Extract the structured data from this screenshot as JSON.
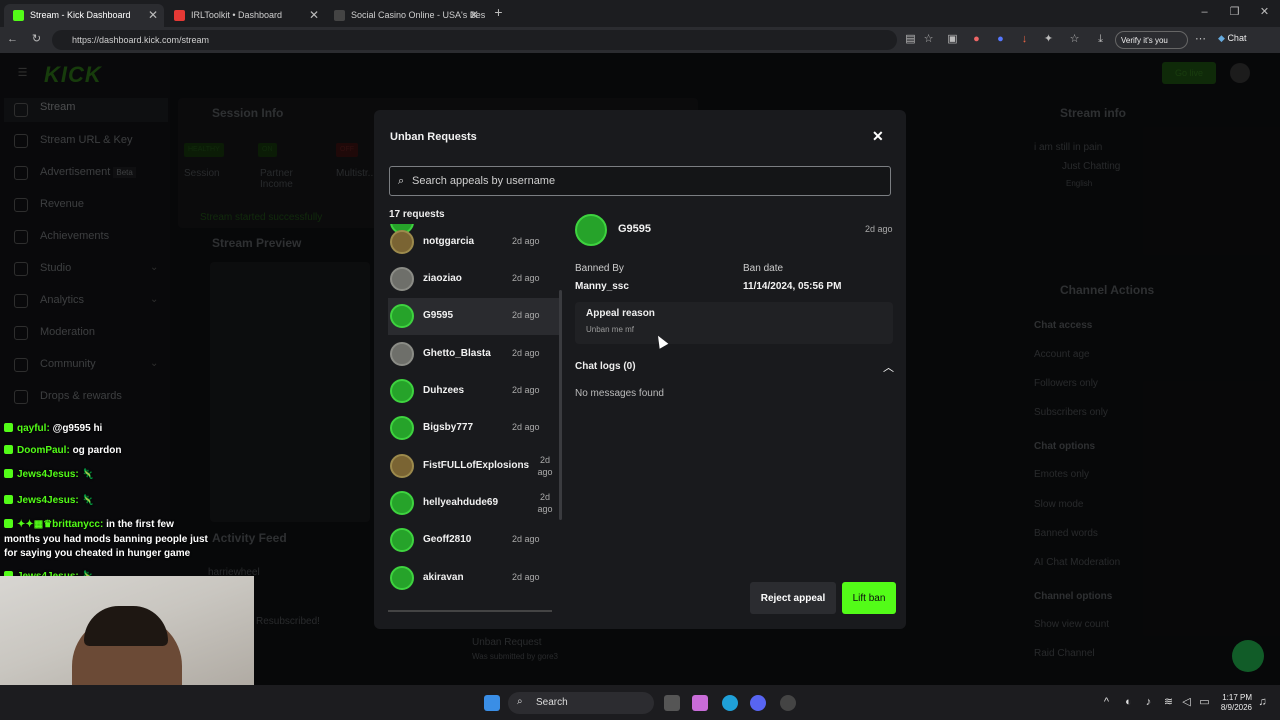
{
  "browser": {
    "tabs": [
      {
        "label": "Stream - Kick Dashboard",
        "color": "#53fc18"
      },
      {
        "label": "IRLToolkit • Dashboard",
        "color": "#e53935"
      },
      {
        "label": "Social Casino Online - USA's Best",
        "color": "#333"
      }
    ],
    "url": "https://dashboard.kick.com/stream",
    "verify_label": "Verify it's you",
    "chat_label": "Chat"
  },
  "sidebar": {
    "logo": "KICK",
    "items": [
      {
        "label": "Stream"
      },
      {
        "label": "Stream URL & Key"
      },
      {
        "label": "Advertisement",
        "badge": "Beta"
      },
      {
        "label": "Revenue"
      },
      {
        "label": "Achievements"
      },
      {
        "label": "Studio"
      },
      {
        "label": "Analytics"
      },
      {
        "label": "Moderation"
      },
      {
        "label": "Community"
      },
      {
        "label": "Drops & rewards"
      }
    ]
  },
  "background": {
    "session_info": "Session Info",
    "healthy": "HEALTHY",
    "on": "ON",
    "off": "OFF",
    "session": "Session",
    "partner_income": "Partner Income",
    "multistream": "Multistr...",
    "stream_started": "Stream started successfully",
    "stream_preview": "Stream Preview",
    "activity_feed": "Activity Feed",
    "activity_user": "harriewheel",
    "resubscribed": "Resubscribed!",
    "unban_request": "Unban Request",
    "unban_sub": "Was submitted by gore3",
    "stream_info": "Stream info",
    "stream_title": "i am still in pain",
    "category": "Just Chatting",
    "language": "English",
    "channel_actions": "Channel Actions",
    "chat_access": "Chat access",
    "account_age": "Account age",
    "followers_only": "Followers only",
    "subscribers_only": "Subscribers only",
    "chat_options": "Chat options",
    "emotes_only": "Emotes only",
    "slow_mode": "Slow mode",
    "banned_words": "Banned words",
    "ai_moderation": "AI Chat Moderation",
    "channel_options": "Channel options",
    "show_view_count": "Show view count",
    "raid_channel": "Raid Channel",
    "go_live": "Go live"
  },
  "modal": {
    "title": "Unban Requests",
    "search_placeholder": "Search appeals by username",
    "request_count": "17 requests",
    "requests": [
      {
        "name": "notggarcia",
        "ago": "2d ago",
        "avatar": "alt"
      },
      {
        "name": "ziaoziao",
        "ago": "2d ago",
        "avatar": "grey"
      },
      {
        "name": "G9595",
        "ago": "2d ago",
        "avatar": "green",
        "selected": true
      },
      {
        "name": "Ghetto_Blasta",
        "ago": "2d ago",
        "avatar": "grey"
      },
      {
        "name": "Duhzees",
        "ago": "2d ago",
        "avatar": "green"
      },
      {
        "name": "Bigsby777",
        "ago": "2d ago",
        "avatar": "green"
      },
      {
        "name": "FistFULLofExplosions",
        "ago": "2d ago",
        "avatar": "alt"
      },
      {
        "name": "hellyeahdude69",
        "ago": "2d ago",
        "avatar": "green"
      },
      {
        "name": "Geoff2810",
        "ago": "2d ago",
        "avatar": "green"
      },
      {
        "name": "akiravan",
        "ago": "2d ago",
        "avatar": "green"
      }
    ],
    "detail": {
      "name": "G9595",
      "ago": "2d ago",
      "banned_by_label": "Banned By",
      "banned_by": "Manny_ssc",
      "ban_date_label": "Ban date",
      "ban_date": "11/14/2024, 05:56 PM",
      "appeal_reason_label": "Appeal reason",
      "appeal_reason": "Unban me mf",
      "chat_logs_label": "Chat logs (0)",
      "no_messages": "No messages found"
    },
    "reject_label": "Reject appeal",
    "lift_label": "Lift ban"
  },
  "stream_chat": [
    {
      "user": "qayful:",
      "msg": "@g9595 hi"
    },
    {
      "user": "DoomPaul:",
      "msg": "og pardon"
    },
    {
      "user": "Jews4Jesus:",
      "msg": "🦎"
    },
    {
      "user": "Jews4Jesus:",
      "msg": "🦎"
    },
    {
      "user": "brittanycc:",
      "msg": "in the first few"
    },
    {
      "user": "",
      "msg": "months you had mods banning people just"
    },
    {
      "user": "",
      "msg": "for saying you cheated in hunger game"
    },
    {
      "user": "Jews4Jesus:",
      "msg": "🦎"
    }
  ],
  "taskbar": {
    "search_label": "Search",
    "time": "1:17 PM",
    "date": "8/9/2026"
  },
  "colors": {
    "accent": "#53fc18",
    "modal_bg": "#191a1d"
  }
}
